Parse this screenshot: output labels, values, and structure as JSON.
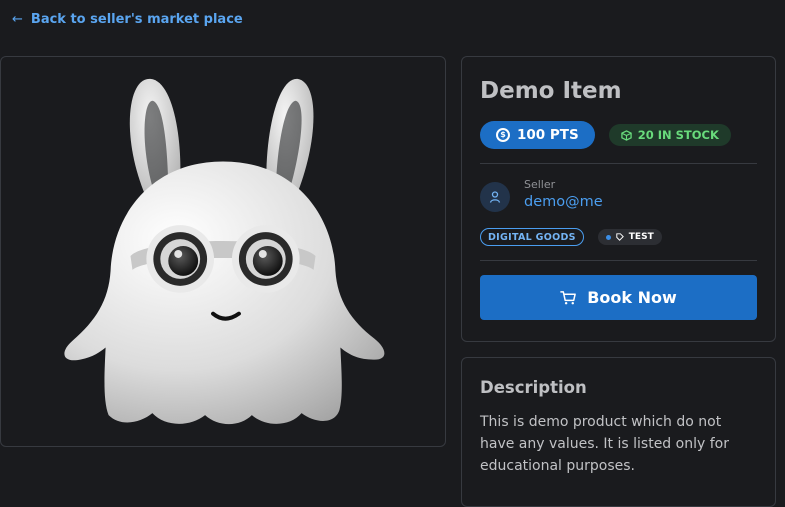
{
  "nav": {
    "back_label": "Back to seller's market place",
    "back_icon": "arrow-left-icon"
  },
  "item": {
    "title": "Demo Item",
    "image_alt": "ghost-bunny-mascot",
    "price_label": "100 PTS",
    "stock_label": "20 IN STOCK"
  },
  "seller": {
    "label": "Seller",
    "email": "demo@me"
  },
  "tags": {
    "category": "DIGITAL GOODS",
    "tag": "TEST"
  },
  "actions": {
    "book_label": "Book Now"
  },
  "description": {
    "title": "Description",
    "text": "This is demo product which do not have any values. It is listed only for educational purposes."
  },
  "colors": {
    "background": "#1a1b1e",
    "accent": "#1c6ec5",
    "link": "#4b9ef0",
    "stock_green": "#69db7c",
    "border": "#373a40"
  }
}
